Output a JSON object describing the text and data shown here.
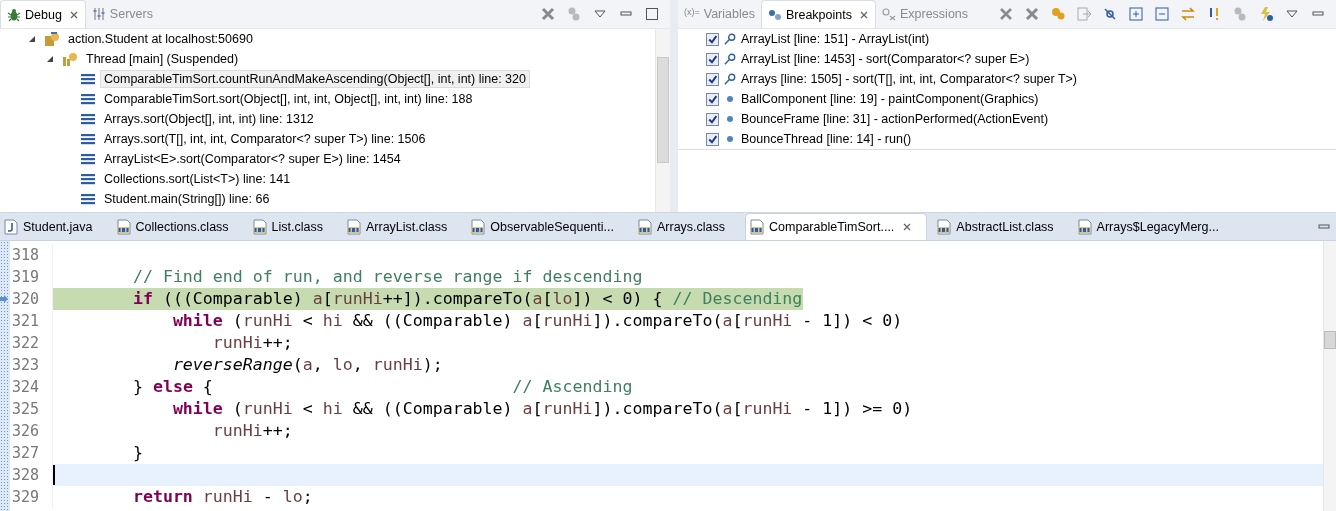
{
  "debug_view": {
    "tabs": [
      {
        "label": "Debug",
        "selected": true,
        "kind": "debug"
      },
      {
        "label": "Servers",
        "selected": false,
        "kind": "servers"
      }
    ],
    "tree": [
      {
        "label": "action.Student at localhost:50690",
        "kind": "launch",
        "expanded": true,
        "selected": false,
        "children": [
          {
            "label": "Thread [main] (Suspended)",
            "kind": "thread",
            "expanded": true,
            "selected": false,
            "children": [
              {
                "label": "ComparableTimSort.countRunAndMakeAscending(Object[], int, int) line: 320",
                "kind": "frame",
                "selected": true
              },
              {
                "label": "ComparableTimSort.sort(Object[], int, int, Object[], int, int) line: 188",
                "kind": "frame",
                "selected": false
              },
              {
                "label": "Arrays.sort(Object[], int, int) line: 1312",
                "kind": "frame",
                "selected": false
              },
              {
                "label": "Arrays.sort(T[], int, int, Comparator<? super T>) line: 1506",
                "kind": "frame",
                "selected": false
              },
              {
                "label": "ArrayList<E>.sort(Comparator<? super E>) line: 1454",
                "kind": "frame",
                "selected": false
              },
              {
                "label": "Collections.sort(List<T>) line: 141",
                "kind": "frame",
                "selected": false
              },
              {
                "label": "Student.main(String[]) line: 66",
                "kind": "frame",
                "selected": false
              }
            ]
          }
        ]
      }
    ]
  },
  "breakpoints_view": {
    "tabs": [
      {
        "label": "Variables",
        "selected": false,
        "kind": "variables",
        "icon_text": "(x)="
      },
      {
        "label": "Breakpoints",
        "selected": true,
        "kind": "breakpoints"
      },
      {
        "label": "Expressions",
        "selected": false,
        "kind": "expressions"
      }
    ],
    "breakpoints": [
      {
        "label": "ArrayList [line: 151] - ArrayList(int)",
        "checked": true,
        "kind": "installed"
      },
      {
        "label": "ArrayList [line: 1453] - sort(Comparator<? super E>)",
        "checked": true,
        "kind": "installed"
      },
      {
        "label": "Arrays [line: 1505] - sort(T[], int, int, Comparator<? super T>)",
        "checked": true,
        "kind": "installed"
      },
      {
        "label": "BallComponent [line: 19] - paintComponent(Graphics)",
        "checked": true,
        "kind": "plain"
      },
      {
        "label": "BounceFrame [line: 31] - actionPerformed(ActionEvent)",
        "checked": true,
        "kind": "plain"
      },
      {
        "label": "BounceThread [line: 14] - run()",
        "checked": true,
        "kind": "plain"
      }
    ]
  },
  "editor": {
    "tabs": [
      {
        "label": "Student.java",
        "kind": "java",
        "selected": false
      },
      {
        "label": "Collections.class",
        "kind": "class",
        "selected": false
      },
      {
        "label": "List.class",
        "kind": "class",
        "selected": false
      },
      {
        "label": "ArrayList.class",
        "kind": "class",
        "selected": false
      },
      {
        "label": "ObservableSequenti...",
        "kind": "class",
        "selected": false
      },
      {
        "label": "Arrays.class",
        "kind": "class",
        "selected": false
      },
      {
        "label": "ComparableTimSort....",
        "kind": "class",
        "selected": true
      },
      {
        "label": "AbstractList.class",
        "kind": "class",
        "selected": false
      },
      {
        "label": "Arrays$LegacyMerg...",
        "kind": "class",
        "selected": false
      }
    ],
    "lines": [
      {
        "number": "318",
        "current_instruction": false,
        "cursor_line": false
      },
      {
        "number": "319",
        "current_instruction": false,
        "cursor_line": false,
        "tokens": [
          {
            "text": "        // Find end of run, and reverse range if descending",
            "kind": "comment"
          }
        ]
      },
      {
        "number": "320",
        "current_instruction": true,
        "cursor_line": false,
        "tokens": [
          {
            "text": "        if",
            "kind": "keyword"
          },
          {
            "text": " (((Comparable) ",
            "kind": "plain"
          },
          {
            "text": "a",
            "kind": "local"
          },
          {
            "text": "[",
            "kind": "plain"
          },
          {
            "text": "runHi",
            "kind": "local"
          },
          {
            "text": "++]).compareTo(",
            "kind": "plain"
          },
          {
            "text": "a",
            "kind": "local"
          },
          {
            "text": "[",
            "kind": "plain"
          },
          {
            "text": "lo",
            "kind": "local"
          },
          {
            "text": "]) < 0) { ",
            "kind": "plain"
          },
          {
            "text": "// Descending",
            "kind": "comment"
          }
        ]
      },
      {
        "number": "321",
        "current_instruction": false,
        "cursor_line": false,
        "tokens": [
          {
            "text": "            while",
            "kind": "keyword"
          },
          {
            "text": " (",
            "kind": "plain"
          },
          {
            "text": "runHi",
            "kind": "local"
          },
          {
            "text": " < ",
            "kind": "plain"
          },
          {
            "text": "hi",
            "kind": "local"
          },
          {
            "text": " && ((Comparable) ",
            "kind": "plain"
          },
          {
            "text": "a",
            "kind": "local"
          },
          {
            "text": "[",
            "kind": "plain"
          },
          {
            "text": "runHi",
            "kind": "local"
          },
          {
            "text": "]).compareTo(",
            "kind": "plain"
          },
          {
            "text": "a",
            "kind": "local"
          },
          {
            "text": "[",
            "kind": "plain"
          },
          {
            "text": "runHi",
            "kind": "local"
          },
          {
            "text": " - 1]) < 0)",
            "kind": "plain"
          }
        ]
      },
      {
        "number": "322",
        "current_instruction": false,
        "cursor_line": false,
        "tokens": [
          {
            "text": "                runHi",
            "kind": "local"
          },
          {
            "text": "++;",
            "kind": "plain"
          }
        ]
      },
      {
        "number": "323",
        "current_instruction": false,
        "cursor_line": false,
        "tokens": [
          {
            "text": "            reverseRange",
            "kind": "static"
          },
          {
            "text": "(",
            "kind": "plain"
          },
          {
            "text": "a",
            "kind": "local"
          },
          {
            "text": ", ",
            "kind": "plain"
          },
          {
            "text": "lo",
            "kind": "local"
          },
          {
            "text": ", ",
            "kind": "plain"
          },
          {
            "text": "runHi",
            "kind": "local"
          },
          {
            "text": ");",
            "kind": "plain"
          }
        ]
      },
      {
        "number": "324",
        "current_instruction": false,
        "cursor_line": false,
        "tokens": [
          {
            "text": "        } ",
            "kind": "plain"
          },
          {
            "text": "else",
            "kind": "keyword"
          },
          {
            "text": " {                              ",
            "kind": "plain"
          },
          {
            "text": "// Ascending",
            "kind": "comment"
          }
        ]
      },
      {
        "number": "325",
        "current_instruction": false,
        "cursor_line": false,
        "tokens": [
          {
            "text": "            while",
            "kind": "keyword"
          },
          {
            "text": " (",
            "kind": "plain"
          },
          {
            "text": "runHi",
            "kind": "local"
          },
          {
            "text": " < ",
            "kind": "plain"
          },
          {
            "text": "hi",
            "kind": "local"
          },
          {
            "text": " && ((Comparable) ",
            "kind": "plain"
          },
          {
            "text": "a",
            "kind": "local"
          },
          {
            "text": "[",
            "kind": "plain"
          },
          {
            "text": "runHi",
            "kind": "local"
          },
          {
            "text": "]).compareTo(",
            "kind": "plain"
          },
          {
            "text": "a",
            "kind": "local"
          },
          {
            "text": "[",
            "kind": "plain"
          },
          {
            "text": "runHi",
            "kind": "local"
          },
          {
            "text": " - 1]) >= 0)",
            "kind": "plain"
          }
        ]
      },
      {
        "number": "326",
        "current_instruction": false,
        "cursor_line": false,
        "tokens": [
          {
            "text": "                runHi",
            "kind": "local"
          },
          {
            "text": "++;",
            "kind": "plain"
          }
        ]
      },
      {
        "number": "327",
        "current_instruction": false,
        "cursor_line": false,
        "tokens": [
          {
            "text": "        }",
            "kind": "plain"
          }
        ]
      },
      {
        "number": "328",
        "current_instruction": false,
        "cursor_line": true
      },
      {
        "number": "329",
        "current_instruction": false,
        "cursor_line": false,
        "tokens": [
          {
            "text": "        return ",
            "kind": "keyword"
          },
          {
            "text": "runHi",
            "kind": "local"
          },
          {
            "text": " - ",
            "kind": "plain"
          },
          {
            "text": "lo",
            "kind": "local"
          },
          {
            "text": ";",
            "kind": "plain"
          }
        ]
      }
    ]
  }
}
